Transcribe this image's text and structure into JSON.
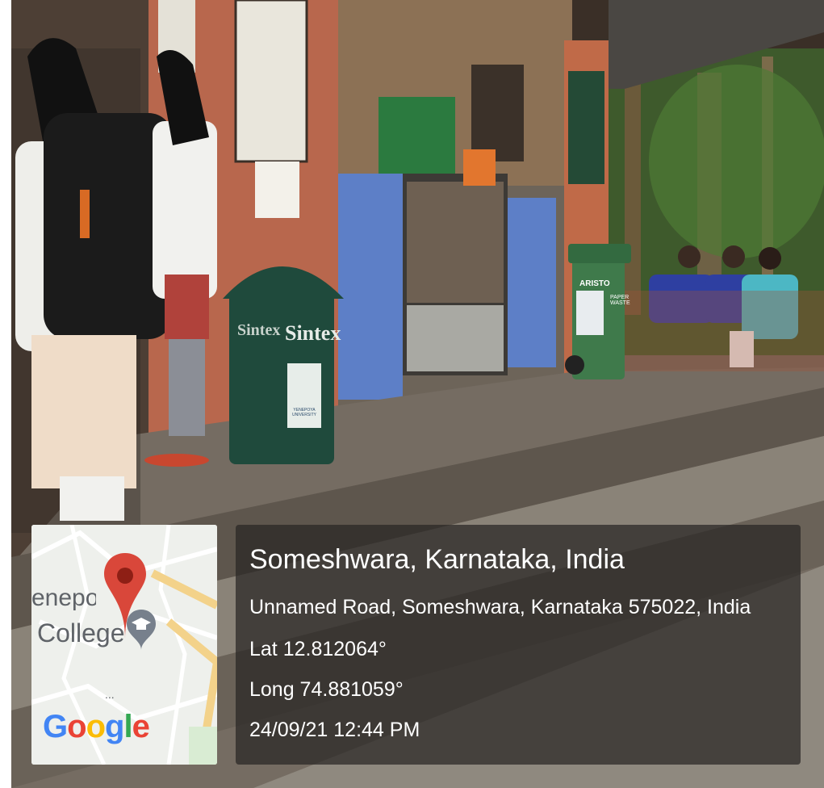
{
  "location": {
    "title": "Someshwara, Karnataka, India",
    "address": "Unnamed Road, Someshwara, Karnataka 575022, India",
    "latitude": "Lat 12.812064°",
    "longitude": "Long 74.881059°",
    "datetime": "24/09/21 12:44 PM"
  },
  "map": {
    "place_label_top": "enepoya",
    "place_label_bottom": "College",
    "more_indicator": "...",
    "google_logo": "Google",
    "pin_icon": "location-pin-icon",
    "college_icon": "graduation-cap-icon"
  },
  "scene": {
    "bin_brand": "Sintex",
    "bin_brand_side": "Sintex",
    "bin_logo": "YENEPOYA UNIVERSITY",
    "green_bin_brand": "ARISTO",
    "green_bin_label": "PAPER WASTE"
  },
  "colors": {
    "pin": "#d9473a",
    "bin_dark": "#1f4a3c",
    "bin_green": "#3f7a4b",
    "tile_blue": "#5d7fc7"
  }
}
